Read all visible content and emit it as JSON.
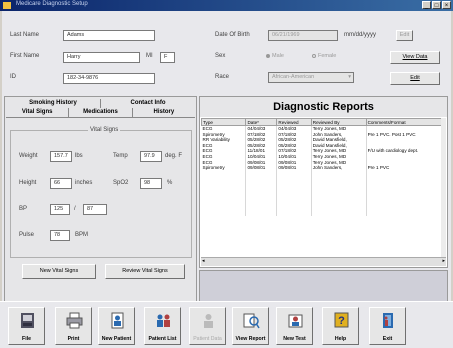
{
  "window": {
    "title": "Medicare Diagnostic Setup"
  },
  "patient": {
    "last_name_label": "Last Name",
    "last_name": "Adams",
    "first_name_label": "First Name",
    "first_name": "Harry",
    "mi_label": "MI",
    "mi": "F",
    "id_label": "ID",
    "id": "182-34-9876",
    "dob_label": "Date Of Birth",
    "dob": "06/21/1969",
    "dob_format": "mm/dd/yyyy",
    "dob_button": "Edit",
    "sex_label": "Sex",
    "sex_male": "Male",
    "sex_female": "Female",
    "race_label": "Race",
    "race": "African-American"
  },
  "buttons": {
    "view_data": "View Data",
    "edit": "Edit",
    "new_vital_signs": "New Vital Signs",
    "review_vital_signs": "Review Vital Signs"
  },
  "tabs": {
    "row1": [
      "Smoking History",
      "Contact Info"
    ],
    "row2": [
      "Vital Signs",
      "Medications",
      "History"
    ]
  },
  "vitals": {
    "title": "Vital Signs",
    "weight_label": "Weight",
    "weight": "157.7",
    "weight_unit": "lbs",
    "temp_label": "Temp",
    "temp": "97.9",
    "temp_unit": "deg. F",
    "height_label": "Height",
    "height": "66",
    "height_unit": "inches",
    "spo2_label": "SpO2",
    "spo2": "98",
    "spo2_unit": "%",
    "bp_label": "BP",
    "bp_sys": "125",
    "bp_sep": "/",
    "bp_dia": "87",
    "pulse_label": "Pulse",
    "pulse": "78",
    "pulse_unit": "BPM"
  },
  "reports": {
    "title": "Diagnostic Reports",
    "columns": [
      "Type",
      "Date*",
      "Reviewed",
      "Reviewed By",
      "Comments/Format"
    ],
    "rows": [
      [
        "ECG",
        "04/04/03",
        "04/04/03",
        "Terry Jones, MD",
        ""
      ],
      [
        "Spirometry",
        "07/18/02",
        "07/18/02",
        "John Sanders,",
        "Pre 1 PVC. Post 1 PVC"
      ],
      [
        "RR Variability",
        "05/28/02",
        "05/28/02",
        "David Mansfield,",
        ""
      ],
      [
        "ECG",
        "05/28/02",
        "05/28/02",
        "David Mansfield,",
        ""
      ],
      [
        "ECG",
        "11/18/01",
        "07/18/02",
        "Terry Jones, MD",
        "F/U with cardiology dept."
      ],
      [
        "ECG",
        "10/04/01",
        "10/04/01",
        "Terry Jones, MD",
        ""
      ],
      [
        "ECG",
        "09/08/01",
        "09/08/01",
        "Terry Jones, MD",
        ""
      ],
      [
        "Spirometry",
        "09/08/01",
        "09/08/01",
        "John Sanders,",
        "Pre 1 PVC"
      ]
    ]
  },
  "toolbar": [
    {
      "label": "File",
      "icon": "file-icon"
    },
    {
      "label": "Print",
      "icon": "printer-icon"
    },
    {
      "label": "New Patient",
      "icon": "new-patient-icon"
    },
    {
      "label": "Patient List",
      "icon": "patient-list-icon"
    },
    {
      "label": "Patient Data",
      "icon": "patient-data-icon"
    },
    {
      "label": "View Report",
      "icon": "view-report-icon"
    },
    {
      "label": "New Test",
      "icon": "new-test-icon"
    },
    {
      "label": "Help",
      "icon": "help-icon"
    },
    {
      "label": "Exit",
      "icon": "exit-icon"
    }
  ],
  "colors": {
    "titlebar": "#0a246a",
    "accent": "#3a6ea5"
  }
}
